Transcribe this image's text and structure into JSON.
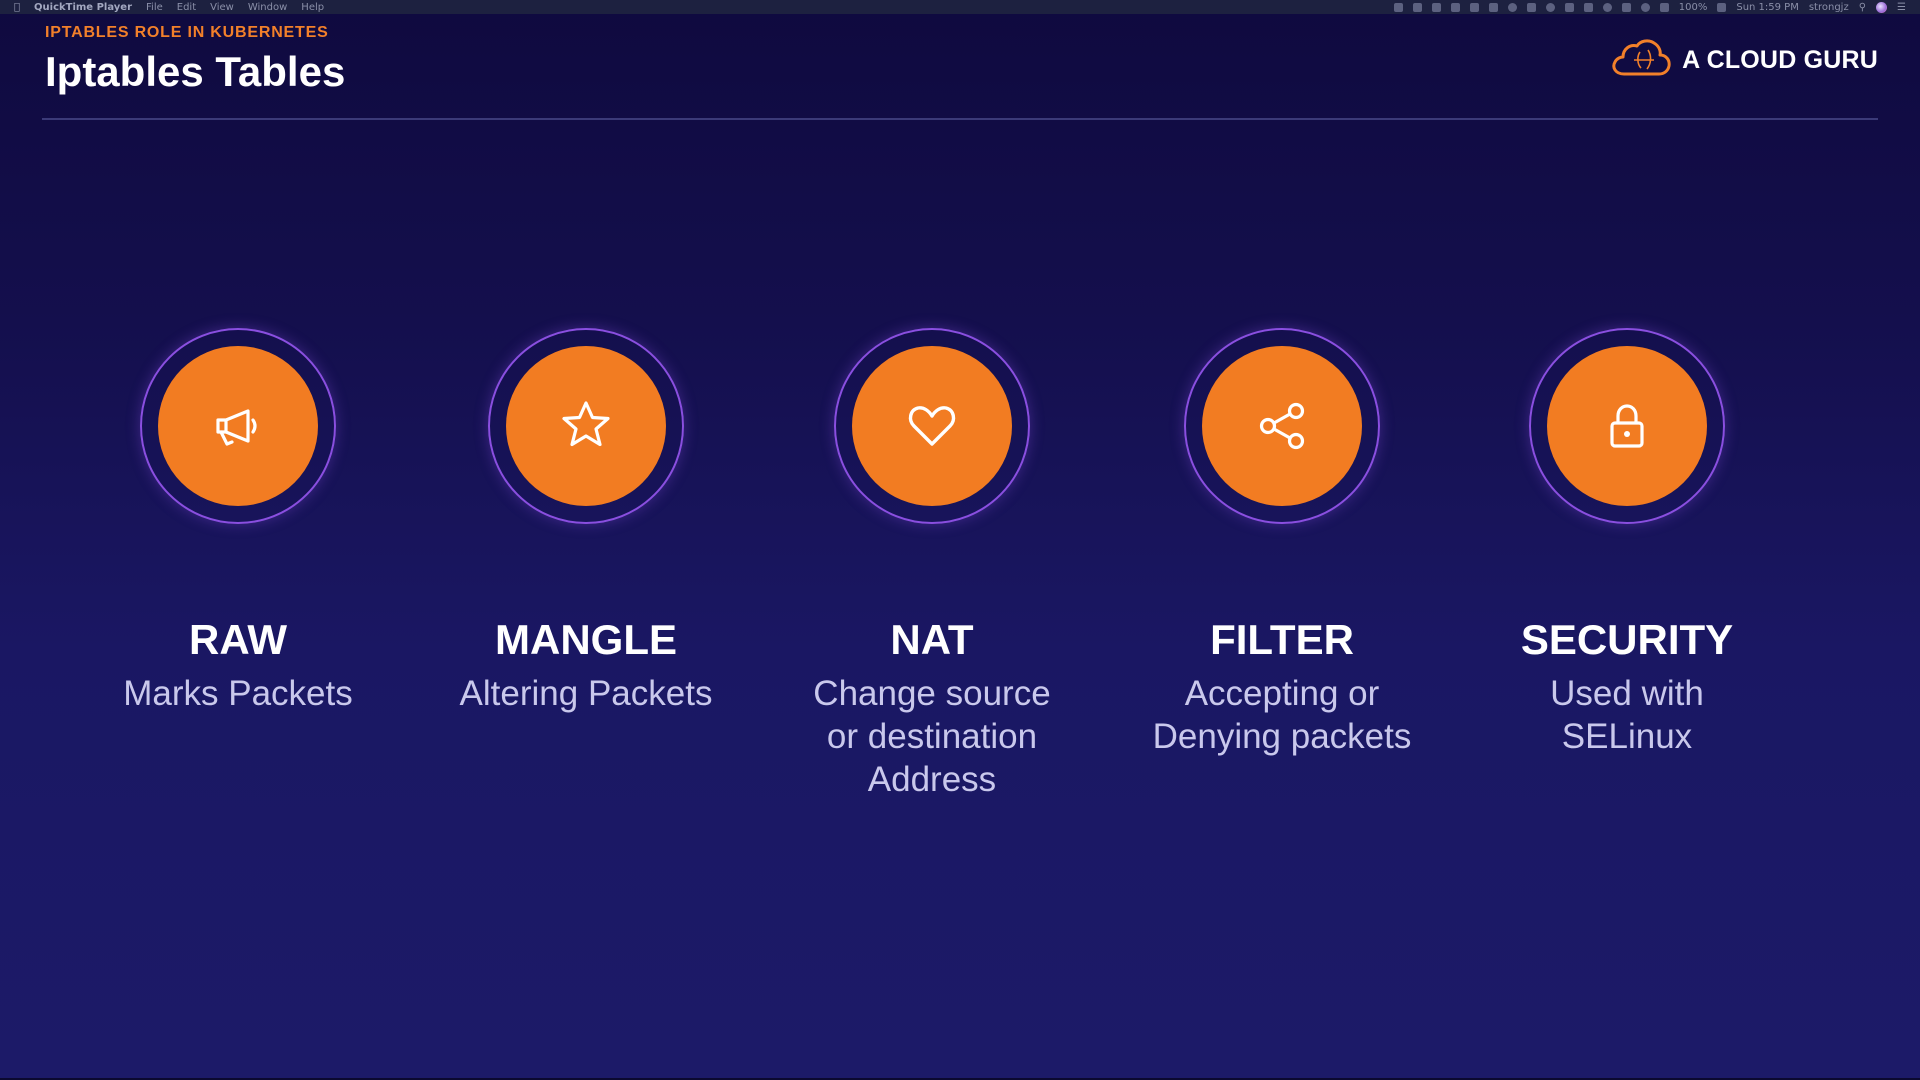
{
  "menubar": {
    "app_name": "QuickTime Player",
    "menus": [
      "File",
      "Edit",
      "View",
      "Window",
      "Help"
    ],
    "battery": "100%",
    "clock": "Sun 1:59 PM",
    "user": "strongjz"
  },
  "slide": {
    "kicker": "IPTABLES ROLE IN KUBERNETES",
    "title": "Iptables Tables",
    "brand": "A CLOUD GURU",
    "cards": [
      {
        "icon": "megaphone-icon",
        "title": "RAW",
        "description": "Marks Packets"
      },
      {
        "icon": "star-icon",
        "title": "MANGLE",
        "description": "Altering Packets"
      },
      {
        "icon": "heart-icon",
        "title": "NAT",
        "description": "Change source\nor destination\nAddress"
      },
      {
        "icon": "share-icon",
        "title": "FILTER",
        "description": "Accepting or\nDenying packets"
      },
      {
        "icon": "lock-icon",
        "title": "SECURITY",
        "description": "Used with\nSELinux"
      }
    ]
  },
  "colors": {
    "accent_orange": "#f27c22",
    "ring_purple": "#8a4fe0",
    "background_top": "#0f0a3f",
    "background_bottom": "#1c1a68"
  }
}
